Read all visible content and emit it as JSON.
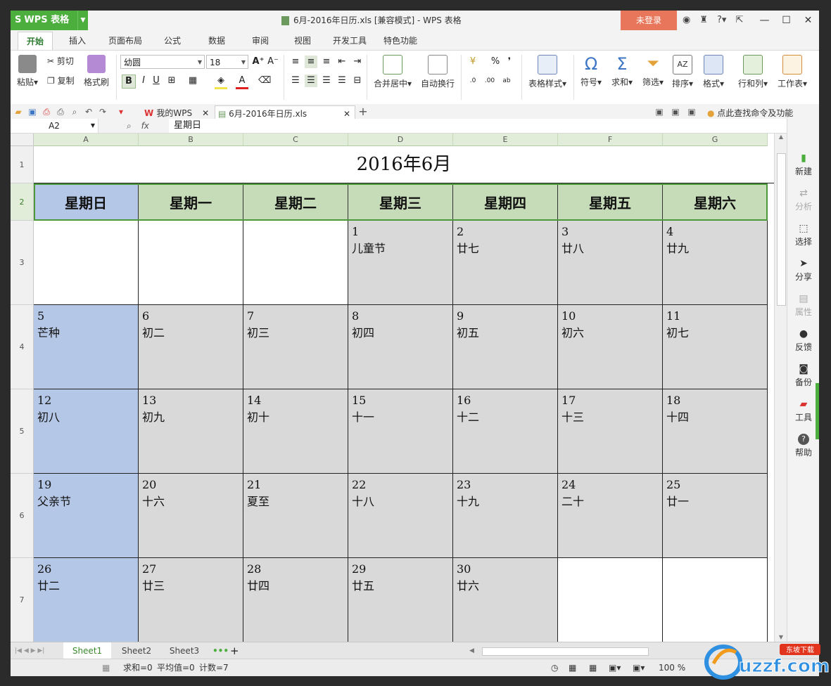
{
  "app": {
    "name": "WPS 表格",
    "logo": "S"
  },
  "window": {
    "title": "6月-2016年日历.xls [兼容模式] - WPS 表格",
    "login": "未登录"
  },
  "ribbon_tabs": [
    "开始",
    "插入",
    "页面布局",
    "公式",
    "数据",
    "审阅",
    "视图",
    "开发工具",
    "特色功能"
  ],
  "ribbon": {
    "paste": "粘贴",
    "cut": "剪切",
    "copy": "复制",
    "format_painter": "格式刷",
    "font": "幼圆",
    "font_size": "18",
    "merge_center": "合并居中",
    "wrap_text": "自动换行",
    "table_style": "表格样式",
    "symbol": "符号",
    "sum": "求和",
    "filter": "筛选",
    "sort": "排序",
    "format": "格式",
    "row_col": "行和列",
    "worksheet": "工作表",
    "percent": "%",
    "thousands": "❜"
  },
  "doc_tabs": {
    "wps_home": "我的WPS",
    "file": "6月-2016年日历.xls"
  },
  "search_hint": "点此查找命令及功能",
  "formula_bar": {
    "cell_ref": "A2",
    "fx": "fx",
    "content": "星期日"
  },
  "columns": [
    "A",
    "B",
    "C",
    "D",
    "E",
    "F",
    "G"
  ],
  "rows": [
    "1",
    "2",
    "3",
    "4",
    "5",
    "6",
    "7"
  ],
  "calendar": {
    "title": "2016年6月",
    "weekdays": [
      "星期日",
      "星期一",
      "星期二",
      "星期三",
      "星期四",
      "星期五",
      "星期六"
    ],
    "weeks": [
      [
        {
          "d": "",
          "l": ""
        },
        {
          "d": "",
          "l": ""
        },
        {
          "d": "",
          "l": ""
        },
        {
          "d": "1",
          "l": "儿童节"
        },
        {
          "d": "2",
          "l": "廿七"
        },
        {
          "d": "3",
          "l": "廿八"
        },
        {
          "d": "4",
          "l": "廿九"
        }
      ],
      [
        {
          "d": "5",
          "l": "芒种"
        },
        {
          "d": "6",
          "l": "初二"
        },
        {
          "d": "7",
          "l": "初三"
        },
        {
          "d": "8",
          "l": "初四"
        },
        {
          "d": "9",
          "l": "初五"
        },
        {
          "d": "10",
          "l": "初六"
        },
        {
          "d": "11",
          "l": "初七"
        }
      ],
      [
        {
          "d": "12",
          "l": "初八"
        },
        {
          "d": "13",
          "l": "初九"
        },
        {
          "d": "14",
          "l": "初十"
        },
        {
          "d": "15",
          "l": "十一"
        },
        {
          "d": "16",
          "l": "十二"
        },
        {
          "d": "17",
          "l": "十三"
        },
        {
          "d": "18",
          "l": "十四"
        }
      ],
      [
        {
          "d": "19",
          "l": "父亲节"
        },
        {
          "d": "20",
          "l": "十六"
        },
        {
          "d": "21",
          "l": "夏至"
        },
        {
          "d": "22",
          "l": "十八"
        },
        {
          "d": "23",
          "l": "十九"
        },
        {
          "d": "24",
          "l": "二十"
        },
        {
          "d": "25",
          "l": "廿一"
        }
      ],
      [
        {
          "d": "26",
          "l": "廿二"
        },
        {
          "d": "27",
          "l": "廿三"
        },
        {
          "d": "28",
          "l": "廿四"
        },
        {
          "d": "29",
          "l": "廿五"
        },
        {
          "d": "30",
          "l": "廿六"
        },
        {
          "d": "",
          "l": ""
        },
        {
          "d": "",
          "l": ""
        }
      ]
    ]
  },
  "sidebar": [
    "新建",
    "分析",
    "选择",
    "分享",
    "属性",
    "反馈",
    "备份",
    "工具",
    "帮助"
  ],
  "sheets": [
    "Sheet1",
    "Sheet2",
    "Sheet3"
  ],
  "status": {
    "sum": "求和=0",
    "avg": "平均值=0",
    "count": "计数=7",
    "zoom": "100 %"
  },
  "watermark": {
    "text": "uzzf.com",
    "sub": "东坡下载"
  },
  "colors": {
    "accent": "#4caf3d",
    "sunday": "#b5c7e6",
    "header": "#c6dbb8",
    "weekday": "#d9d9d9",
    "login": "#e8765a"
  }
}
